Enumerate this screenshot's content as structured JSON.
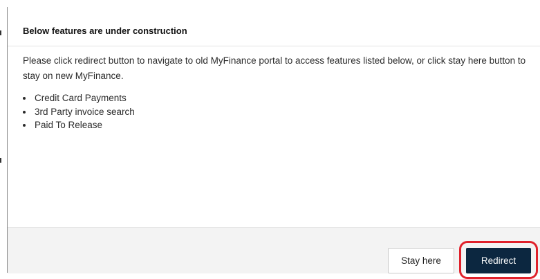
{
  "dialog": {
    "title": "Below features are under construction",
    "message": "Please click redirect button to navigate to old MyFinance portal to access features listed below, or click stay here button to stay on new MyFinance.",
    "features": [
      "Credit Card Payments",
      "3rd Party invoice search",
      "Paid To Release"
    ]
  },
  "buttons": {
    "stay_here": "Stay here",
    "redirect": "Redirect"
  },
  "colors": {
    "redirect_button_bg": "#0c2740",
    "highlight_ring": "#e0212b",
    "footer_bg": "#f3f3f3"
  }
}
